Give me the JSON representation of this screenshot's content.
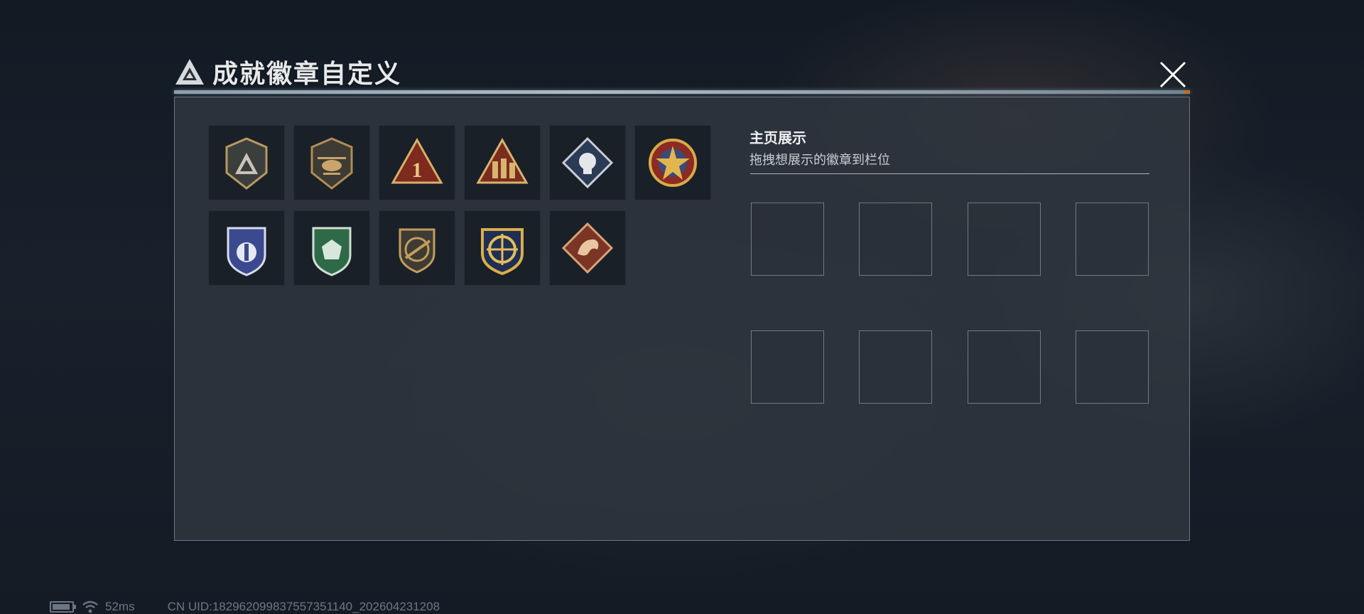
{
  "header": {
    "title": "成就徽章自定义",
    "logo_icon": "triangle-emblem-icon",
    "close_icon": "close-icon"
  },
  "badges": {
    "items": [
      {
        "icon": "triangle-shield-badge-icon"
      },
      {
        "icon": "helicopter-badge-icon"
      },
      {
        "icon": "rank-one-badge-icon"
      },
      {
        "icon": "soldiers-triangle-badge-icon"
      },
      {
        "icon": "fist-diamond-badge-icon"
      },
      {
        "icon": "star-crest-badge-icon"
      },
      {
        "icon": "blue-shield-badge-icon"
      },
      {
        "icon": "green-shield-badge-icon"
      },
      {
        "icon": "rifle-crest-badge-icon"
      },
      {
        "icon": "gold-crosshair-badge-icon"
      },
      {
        "icon": "dragon-diamond-badge-icon"
      }
    ]
  },
  "display": {
    "title": "主页展示",
    "hint": "拖拽想展示的徽章到栏位",
    "slots": 8
  },
  "status_bar": {
    "battery_icon": "battery-icon",
    "wifi_icon": "wifi-icon",
    "ping": "52ms",
    "uid": "CN UID:182962099837557351140_202604231208"
  },
  "colors": {
    "panel": "#30373f",
    "rule_accent": "#d0822e",
    "gold": "#c9a24a"
  }
}
